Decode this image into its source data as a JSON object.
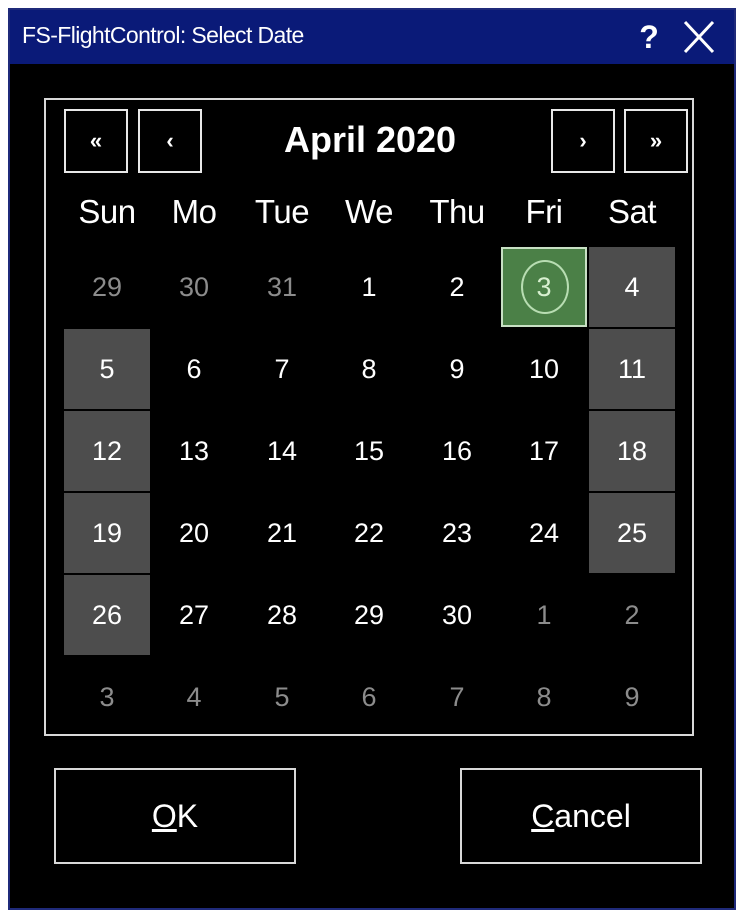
{
  "window": {
    "title": "FS-FlightControl: Select Date",
    "help_label": "?",
    "close_icon": "close-icon"
  },
  "calendar": {
    "month_label": "April 2020",
    "nav": {
      "prev_year": "«",
      "prev_month": "‹",
      "next_month": "›",
      "next_year": "»"
    },
    "weekdays": [
      "Sun",
      "Mo",
      "Tue",
      "We",
      "Thu",
      "Fri",
      "Sat"
    ],
    "weeks": [
      [
        {
          "d": "29",
          "other": true
        },
        {
          "d": "30",
          "other": true
        },
        {
          "d": "31",
          "other": true
        },
        {
          "d": "1"
        },
        {
          "d": "2"
        },
        {
          "d": "3",
          "selected": true
        },
        {
          "d": "4",
          "weekend": true
        }
      ],
      [
        {
          "d": "5",
          "weekend": true
        },
        {
          "d": "6"
        },
        {
          "d": "7"
        },
        {
          "d": "8"
        },
        {
          "d": "9"
        },
        {
          "d": "10"
        },
        {
          "d": "11",
          "weekend": true
        }
      ],
      [
        {
          "d": "12",
          "weekend": true
        },
        {
          "d": "13"
        },
        {
          "d": "14"
        },
        {
          "d": "15"
        },
        {
          "d": "16"
        },
        {
          "d": "17"
        },
        {
          "d": "18",
          "weekend": true
        }
      ],
      [
        {
          "d": "19",
          "weekend": true
        },
        {
          "d": "20"
        },
        {
          "d": "21"
        },
        {
          "d": "22"
        },
        {
          "d": "23"
        },
        {
          "d": "24"
        },
        {
          "d": "25",
          "weekend": true
        }
      ],
      [
        {
          "d": "26",
          "weekend": true
        },
        {
          "d": "27"
        },
        {
          "d": "28"
        },
        {
          "d": "29"
        },
        {
          "d": "30"
        },
        {
          "d": "1",
          "other": true
        },
        {
          "d": "2",
          "other": true
        }
      ],
      [
        {
          "d": "3",
          "other": true
        },
        {
          "d": "4",
          "other": true
        },
        {
          "d": "5",
          "other": true
        },
        {
          "d": "6",
          "other": true
        },
        {
          "d": "7",
          "other": true
        },
        {
          "d": "8",
          "other": true
        },
        {
          "d": "9",
          "other": true
        }
      ]
    ],
    "colors": {
      "selected_bg": "#4b8047",
      "weekend_bg": "#4d4d4d",
      "other_month_text": "#8c8c8c",
      "titlebar_bg": "#0a1a78"
    }
  },
  "buttons": {
    "ok": {
      "mnemonic": "O",
      "rest": "K"
    },
    "cancel": {
      "mnemonic": "C",
      "rest": "ancel"
    }
  }
}
